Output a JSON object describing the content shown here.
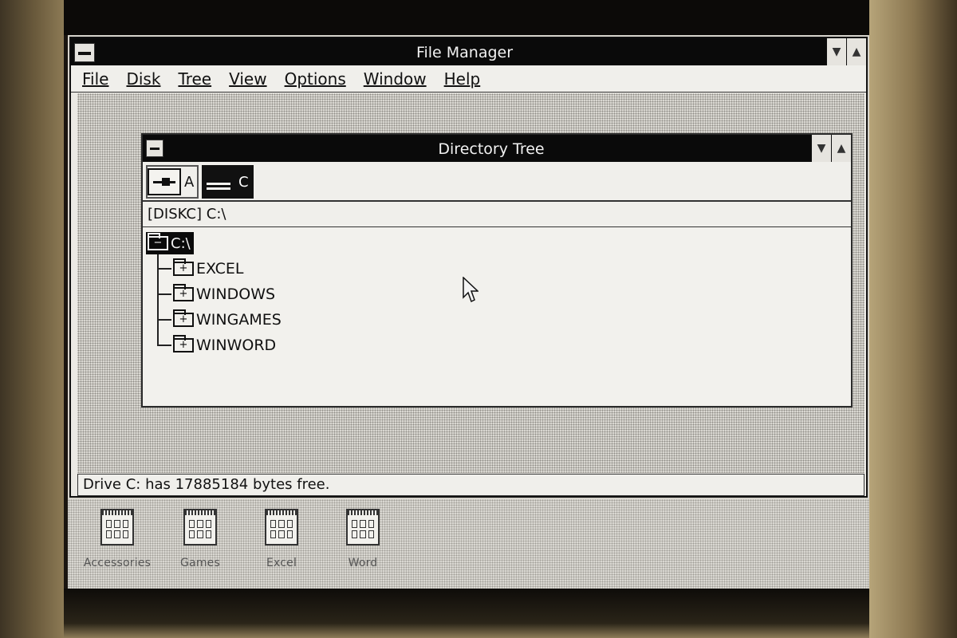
{
  "window": {
    "title": "File Manager"
  },
  "menu": {
    "items": [
      {
        "label": "File"
      },
      {
        "label": "Disk"
      },
      {
        "label": "Tree"
      },
      {
        "label": "View"
      },
      {
        "label": "Options"
      },
      {
        "label": "Window"
      },
      {
        "label": "Help"
      }
    ]
  },
  "directory_tree": {
    "title": "Directory Tree",
    "drives": [
      {
        "letter": "A",
        "icon": "floppy-drive-icon"
      },
      {
        "letter": "C",
        "icon": "hard-drive-icon",
        "selected": true
      }
    ],
    "path": "[DISKC]  C:\\",
    "root": {
      "label": "C:\\",
      "icon": "folder-minus-icon"
    },
    "folders": [
      {
        "label": "EXCEL",
        "icon": "folder-plus-icon"
      },
      {
        "label": "WINDOWS",
        "icon": "folder-plus-icon"
      },
      {
        "label": "WINGAMES",
        "icon": "folder-plus-icon"
      },
      {
        "label": "WINWORD",
        "icon": "folder-plus-icon"
      }
    ]
  },
  "status": {
    "text": "Drive C: has 17885184 bytes free."
  },
  "desktop": {
    "groups": [
      {
        "label": "Accessories"
      },
      {
        "label": "Games"
      },
      {
        "label": "Excel"
      },
      {
        "label": "Word"
      }
    ]
  },
  "colors": {
    "titlebar": "#0a0a0a",
    "window_bg": "#ebe9e4",
    "desktop_bg": "#d9d7d1"
  }
}
